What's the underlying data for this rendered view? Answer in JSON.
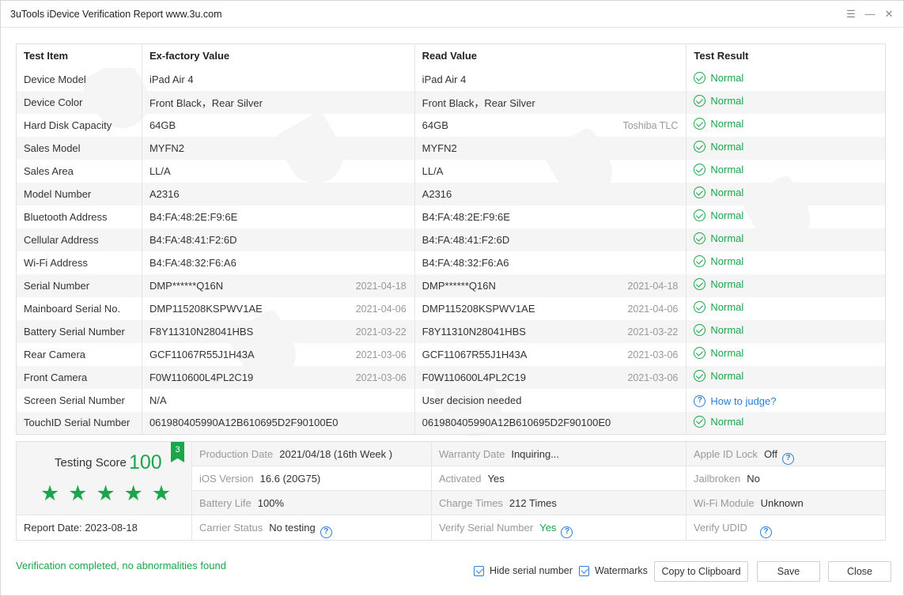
{
  "window": {
    "title": "3uTools iDevice Verification Report www.3u.com"
  },
  "table": {
    "headers": [
      "Test Item",
      "Ex-factory Value",
      "Read Value",
      "Test Result"
    ],
    "rows": [
      {
        "item": "Device Model",
        "factory": "iPad Air 4",
        "factory_date": "",
        "read": "iPad Air 4",
        "read_date": "",
        "result": "Normal",
        "status": "ok"
      },
      {
        "item": "Device Color",
        "factory": "Front Black，Rear Silver",
        "factory_date": "",
        "read": "Front Black，Rear Silver",
        "read_date": "",
        "result": "Normal",
        "status": "ok"
      },
      {
        "item": "Hard Disk Capacity",
        "factory": "64GB",
        "factory_date": "",
        "read": "64GB",
        "read_date": "Toshiba TLC",
        "result": "Normal",
        "status": "ok"
      },
      {
        "item": "Sales Model",
        "factory": "MYFN2",
        "factory_date": "",
        "read": "MYFN2",
        "read_date": "",
        "result": "Normal",
        "status": "ok"
      },
      {
        "item": "Sales Area",
        "factory": "LL/A",
        "factory_date": "",
        "read": "LL/A",
        "read_date": "",
        "result": "Normal",
        "status": "ok"
      },
      {
        "item": "Model Number",
        "factory": "A2316",
        "factory_date": "",
        "read": "A2316",
        "read_date": "",
        "result": "Normal",
        "status": "ok"
      },
      {
        "item": "Bluetooth Address",
        "factory": "B4:FA:48:2E:F9:6E",
        "factory_date": "",
        "read": "B4:FA:48:2E:F9:6E",
        "read_date": "",
        "result": "Normal",
        "status": "ok"
      },
      {
        "item": "Cellular Address",
        "factory": "B4:FA:48:41:F2:6D",
        "factory_date": "",
        "read": "B4:FA:48:41:F2:6D",
        "read_date": "",
        "result": "Normal",
        "status": "ok"
      },
      {
        "item": "Wi-Fi Address",
        "factory": "B4:FA:48:32:F6:A6",
        "factory_date": "",
        "read": "B4:FA:48:32:F6:A6",
        "read_date": "",
        "result": "Normal",
        "status": "ok"
      },
      {
        "item": "Serial Number",
        "factory": "DMP******Q16N",
        "factory_date": "2021-04-18",
        "read": "DMP******Q16N",
        "read_date": "2021-04-18",
        "result": "Normal",
        "status": "ok"
      },
      {
        "item": "Mainboard Serial No.",
        "factory": "DMP115208KSPWV1AE",
        "factory_date": "2021-04-06",
        "read": "DMP115208KSPWV1AE",
        "read_date": "2021-04-06",
        "result": "Normal",
        "status": "ok"
      },
      {
        "item": "Battery Serial Number",
        "factory": "F8Y11310N28041HBS",
        "factory_date": "2021-03-22",
        "read": "F8Y11310N28041HBS",
        "read_date": "2021-03-22",
        "result": "Normal",
        "status": "ok"
      },
      {
        "item": "Rear Camera",
        "factory": "GCF11067R55J1H43A",
        "factory_date": "2021-03-06",
        "read": "GCF11067R55J1H43A",
        "read_date": "2021-03-06",
        "result": "Normal",
        "status": "ok"
      },
      {
        "item": "Front Camera",
        "factory": "F0W110600L4PL2C19",
        "factory_date": "2021-03-06",
        "read": "F0W110600L4PL2C19",
        "read_date": "2021-03-06",
        "result": "Normal",
        "status": "ok"
      },
      {
        "item": "Screen Serial Number",
        "factory": "N/A",
        "factory_date": "",
        "read": "User decision needed",
        "read_date": "",
        "result": "How to judge?",
        "status": "question"
      },
      {
        "item": "TouchID Serial Number",
        "factory": "061980405990A12B610695D2F90100E0",
        "factory_date": "",
        "read": "061980405990A12B610695D2F90100E0",
        "read_date": "",
        "result": "Normal",
        "status": "ok"
      }
    ]
  },
  "summary": {
    "score_label": "Testing Score",
    "score": "100",
    "badge": "3",
    "star_count": 5,
    "report_date_label": "Report Date:",
    "report_date": "2023-08-18",
    "production_date_label": "Production Date",
    "production_date": "2021/04/18 (16th Week )",
    "warranty_label": "Warranty Date",
    "warranty": "Inquiring...",
    "apple_id_label": "Apple ID Lock",
    "apple_id": "Off",
    "ios_label": "iOS Version",
    "ios": "16.6 (20G75)",
    "activated_label": "Activated",
    "activated": "Yes",
    "jailbroken_label": "Jailbroken",
    "jailbroken": "No",
    "battery_label": "Battery Life",
    "battery": "100%",
    "charge_label": "Charge Times",
    "charge": "212 Times",
    "wifi_label": "Wi-Fi Module",
    "wifi": "Unknown",
    "carrier_label": "Carrier Status",
    "carrier": "No testing",
    "verify_serial_label": "Verify Serial Number",
    "verify_serial": "Yes",
    "verify_udid_label": "Verify UDID"
  },
  "footer": {
    "status": "Verification completed, no abnormalities found",
    "hide_serial": "Hide serial number",
    "watermarks": "Watermarks",
    "copy": "Copy to Clipboard",
    "save": "Save",
    "close": "Close"
  },
  "colors": {
    "accent_green": "#1aa64a",
    "link_blue": "#2a7fd8"
  }
}
